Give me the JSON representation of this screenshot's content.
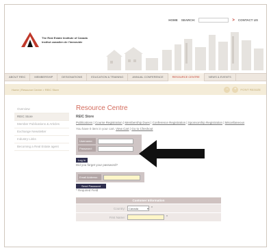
{
  "topbar": {
    "home_label": "HOME",
    "search_label": "SEARCH:",
    "go_symbol": ">",
    "contact_label": "CONTACT US"
  },
  "logo": {
    "line1": "The Real Estate Institute of Canada",
    "line2": "Institut canadien de l'immeuble"
  },
  "nav": {
    "items": [
      {
        "label": "ABOUT REIC"
      },
      {
        "label": "MEMBERSHIP"
      },
      {
        "label": "DESIGNATIONS"
      },
      {
        "label": "EDUCATION & TRAINING"
      },
      {
        "label": "ANNUAL CONFERENCE"
      },
      {
        "label": "RESOURCE CENTRE"
      },
      {
        "label": "NEWS & EVENTS"
      }
    ]
  },
  "breadcrumb": {
    "text": "Home | Resource Centre > REIC Store",
    "minus": "−",
    "plus": "+",
    "font_label": "FONT RESIZE"
  },
  "sidebar": {
    "items": [
      {
        "label": "Overview"
      },
      {
        "label": "REIC Store"
      },
      {
        "label": "Member Publications & Articles"
      },
      {
        "label": "Exchange Newsletter"
      },
      {
        "label": "Industry Links"
      },
      {
        "label": "Becoming a Real Estate agent"
      }
    ]
  },
  "main": {
    "title": "Resource Centre",
    "subtitle": "REIC Store",
    "links": [
      "Publications",
      "Course Registration",
      "Membership Dues",
      "Conference Registration",
      "Sponsorship Registration",
      "Miscellaneous"
    ],
    "cart_prefix": "You have 0 item in your cart.",
    "view_cart": "View Cart",
    "checkout": "Go to Checkout"
  },
  "login": {
    "username_label": "Username:",
    "password_label": "Password:",
    "login_button": "Log In",
    "forgot_text": "Did you forget your password?"
  },
  "email_form": {
    "label": "Email Address:",
    "send_button": "Send Password",
    "required_note": "* Required Field"
  },
  "customer": {
    "header": "Customer Information",
    "country_label": "Country:",
    "country_value": "Canada",
    "first_name_label": "First Name:",
    "required_star": "*"
  },
  "colors": {
    "accent_red": "#c0392b",
    "nav_bg": "#eee7df",
    "crumb_bg": "#f4ecd8",
    "button_dark": "#2f2f4f"
  }
}
